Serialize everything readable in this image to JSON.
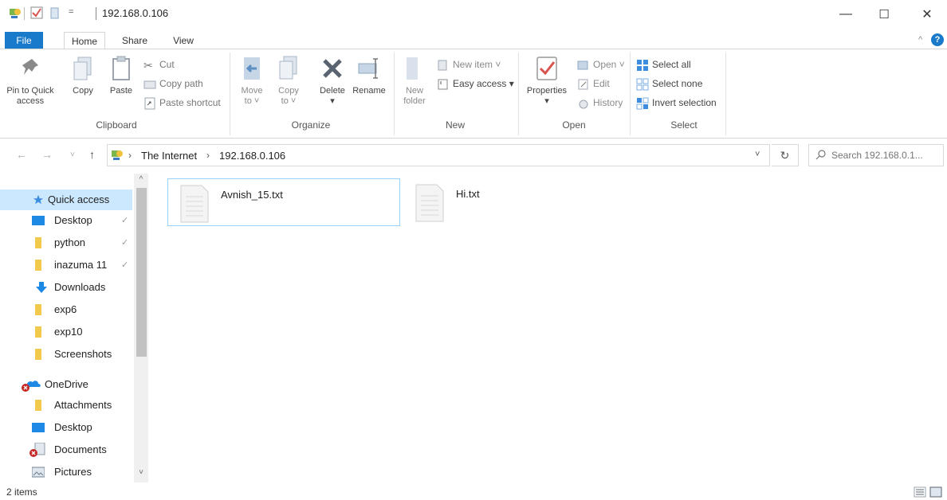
{
  "window": {
    "title": "192.168.0.106",
    "minimize_glyph": "—",
    "maximize_glyph": "☐",
    "close_glyph": "✕"
  },
  "tabs": [
    "File",
    "Home",
    "Share",
    "View"
  ],
  "ribbon": {
    "clipboard": {
      "label": "Clipboard",
      "pin_line1": "Pin to Quick",
      "pin_line2": "access",
      "copy": "Copy",
      "paste": "Paste",
      "cut": "Cut",
      "copy_path": "Copy path",
      "paste_shortcut": "Paste shortcut"
    },
    "organize": {
      "label": "Organize",
      "move_line1": "Move",
      "move_line2": "to ˅",
      "copy_line1": "Copy",
      "copy_line2": "to ˅",
      "delete": "Delete",
      "delete_arrow": "▾",
      "rename": "Rename"
    },
    "new": {
      "label": "New",
      "folder_line1": "New",
      "folder_line2": "folder",
      "new_item": "New item ˅",
      "easy_access": "Easy access ▾"
    },
    "open": {
      "label": "Open",
      "properties": "Properties",
      "properties_arrow": "▾",
      "open": "Open ˅",
      "edit": "Edit",
      "history": "History"
    },
    "select": {
      "label": "Select",
      "select_all": "Select all",
      "select_none": "Select none",
      "invert": "Invert selection"
    }
  },
  "address": {
    "crumbs": [
      "The Internet",
      "192.168.0.106"
    ],
    "separator": "›",
    "search_placeholder": "Search 192.168.0.1..."
  },
  "sidebar": {
    "items": [
      {
        "label": "Quick access",
        "icon": "star-icon"
      },
      {
        "label": "Desktop",
        "icon": "desktop-icon",
        "pinned": true
      },
      {
        "label": "python",
        "icon": "folder-icon",
        "pinned": true
      },
      {
        "label": "inazuma 11",
        "icon": "folder-icon",
        "pinned": true
      },
      {
        "label": "Downloads",
        "icon": "download-icon"
      },
      {
        "label": "exp6",
        "icon": "folder-icon"
      },
      {
        "label": "exp10",
        "icon": "folder-icon"
      },
      {
        "label": "Screenshots",
        "icon": "folder-icon"
      },
      {
        "label": "OneDrive",
        "icon": "cloud-icon"
      },
      {
        "label": "Attachments",
        "icon": "folder-icon"
      },
      {
        "label": "Desktop",
        "icon": "desktop-icon"
      },
      {
        "label": "Documents",
        "icon": "documents-icon"
      },
      {
        "label": "Pictures",
        "icon": "pictures-icon"
      }
    ],
    "pin_glyph": "✓"
  },
  "files": [
    {
      "name": "Avnish_15.txt",
      "selected": true
    },
    {
      "name": "Hi.txt",
      "selected": false
    }
  ],
  "status": {
    "text": "2 items"
  },
  "colors": {
    "accent": "#1979ca",
    "selection": "#cce8ff",
    "selection_border": "#99d1ff"
  }
}
